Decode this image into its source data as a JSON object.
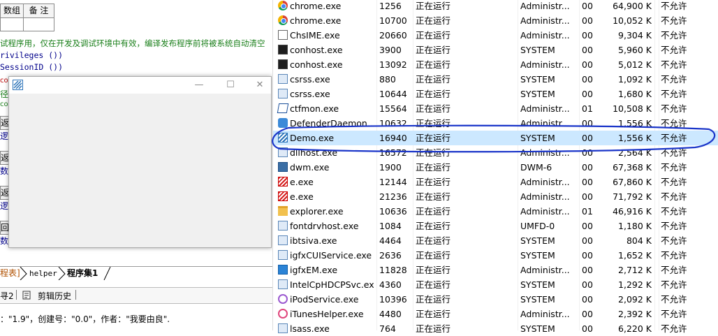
{
  "ide": {
    "table_headers": [
      "数组",
      "备 注"
    ],
    "code_lines": [
      {
        "text": "试程序用，仅在开发及调试环境中有效，编译发布程序前将被系统自动清空",
        "kind": "comment"
      },
      {
        "text": "rivileges ())",
        "kind": "code"
      },
      {
        "text": "SessionID ())",
        "kind": "code"
      }
    ],
    "side_fragments": [
      "co",
      "径",
      "co",
      "返回",
      "逻辑",
      "返",
      "数",
      "返回",
      "逻辑",
      "回",
      "数"
    ],
    "tabs": [
      "程表]",
      "helper",
      "程序集1"
    ],
    "bottom_tabs": [
      "寻2",
      "剪辑历史"
    ],
    "status_text": "：\"1.9\"，创建号：\"0.0\"，作者：\"我要由良\"."
  },
  "demo_window": {
    "minimize": "—",
    "maximize": "☐",
    "close": "✕"
  },
  "processes": [
    {
      "name": "chrome.exe",
      "pid": "1256",
      "status": "正在运行",
      "user": "Administr...",
      "cpu": "00",
      "mem": "64,900 K",
      "uac": "不允许",
      "icon": "chrome-icon"
    },
    {
      "name": "chrome.exe",
      "pid": "10700",
      "status": "正在运行",
      "user": "Administr...",
      "cpu": "00",
      "mem": "10,052 K",
      "uac": "不允许",
      "icon": "chrome-icon"
    },
    {
      "name": "ChsIME.exe",
      "pid": "20660",
      "status": "正在运行",
      "user": "Administr...",
      "cpu": "00",
      "mem": "9,304 K",
      "uac": "不允许",
      "icon": "ime-icon"
    },
    {
      "name": "conhost.exe",
      "pid": "3900",
      "status": "正在运行",
      "user": "SYSTEM",
      "cpu": "00",
      "mem": "5,960 K",
      "uac": "不允许",
      "icon": "console-icon"
    },
    {
      "name": "conhost.exe",
      "pid": "13092",
      "status": "正在运行",
      "user": "Administr...",
      "cpu": "00",
      "mem": "5,012 K",
      "uac": "不允许",
      "icon": "console-icon"
    },
    {
      "name": "csrss.exe",
      "pid": "880",
      "status": "正在运行",
      "user": "SYSTEM",
      "cpu": "00",
      "mem": "1,092 K",
      "uac": "不允许",
      "icon": "process-icon"
    },
    {
      "name": "csrss.exe",
      "pid": "10644",
      "status": "正在运行",
      "user": "SYSTEM",
      "cpu": "00",
      "mem": "1,680 K",
      "uac": "不允许",
      "icon": "process-icon"
    },
    {
      "name": "ctfmon.exe",
      "pid": "15564",
      "status": "正在运行",
      "user": "Administr...",
      "cpu": "01",
      "mem": "10,508 K",
      "uac": "不允许",
      "icon": "ctfmon-icon"
    },
    {
      "name": "DefenderDaemon...",
      "pid": "10632",
      "status": "正在运行",
      "user": "Administr...",
      "cpu": "00",
      "mem": "1,556 K",
      "uac": "不允许",
      "icon": "defender-icon"
    },
    {
      "name": "Demo.exe",
      "pid": "16940",
      "status": "正在运行",
      "user": "SYSTEM",
      "cpu": "00",
      "mem": "1,556 K",
      "uac": "不允许",
      "icon": "demo-icon",
      "selected": true
    },
    {
      "name": "dllhost.exe",
      "pid": "16572",
      "status": "正在运行",
      "user": "Administr...",
      "cpu": "00",
      "mem": "2,564 K",
      "uac": "不允许",
      "icon": "process-icon"
    },
    {
      "name": "dwm.exe",
      "pid": "1900",
      "status": "正在运行",
      "user": "DWM-6",
      "cpu": "00",
      "mem": "67,368 K",
      "uac": "不允许",
      "icon": "dwm-icon"
    },
    {
      "name": "e.exe",
      "pid": "12144",
      "status": "正在运行",
      "user": "Administr...",
      "cpu": "00",
      "mem": "67,860 K",
      "uac": "不允许",
      "icon": "e-icon"
    },
    {
      "name": "e.exe",
      "pid": "21236",
      "status": "正在运行",
      "user": "Administr...",
      "cpu": "00",
      "mem": "71,792 K",
      "uac": "不允许",
      "icon": "e-icon"
    },
    {
      "name": "explorer.exe",
      "pid": "10636",
      "status": "正在运行",
      "user": "Administr...",
      "cpu": "01",
      "mem": "46,916 K",
      "uac": "不允许",
      "icon": "folder-icon"
    },
    {
      "name": "fontdrvhost.exe",
      "pid": "1084",
      "status": "正在运行",
      "user": "UMFD-0",
      "cpu": "00",
      "mem": "1,180 K",
      "uac": "不允许",
      "icon": "process-icon"
    },
    {
      "name": "ibtsiva.exe",
      "pid": "4464",
      "status": "正在运行",
      "user": "SYSTEM",
      "cpu": "00",
      "mem": "804 K",
      "uac": "不允许",
      "icon": "process-icon"
    },
    {
      "name": "igfxCUIService.exe",
      "pid": "2636",
      "status": "正在运行",
      "user": "SYSTEM",
      "cpu": "00",
      "mem": "1,652 K",
      "uac": "不允许",
      "icon": "process-icon"
    },
    {
      "name": "igfxEM.exe",
      "pid": "11828",
      "status": "正在运行",
      "user": "Administr...",
      "cpu": "00",
      "mem": "2,712 K",
      "uac": "不允许",
      "icon": "intel-icon"
    },
    {
      "name": "IntelCpHDCPSvc.exe",
      "pid": "4360",
      "status": "正在运行",
      "user": "SYSTEM",
      "cpu": "00",
      "mem": "1,292 K",
      "uac": "不允许",
      "icon": "process-icon"
    },
    {
      "name": "iPodService.exe",
      "pid": "10396",
      "status": "正在运行",
      "user": "SYSTEM",
      "cpu": "00",
      "mem": "2,092 K",
      "uac": "不允许",
      "icon": "ipod-icon"
    },
    {
      "name": "iTunesHelper.exe",
      "pid": "4480",
      "status": "正在运行",
      "user": "Administr...",
      "cpu": "00",
      "mem": "2,392 K",
      "uac": "不允许",
      "icon": "itunes-icon"
    },
    {
      "name": "lsass.exe",
      "pid": "764",
      "status": "正在运行",
      "user": "SYSTEM",
      "cpu": "00",
      "mem": "6,220 K",
      "uac": "不允许",
      "icon": "process-icon"
    }
  ],
  "colors": {
    "selection": "#cce8ff",
    "annotation": "#1a35c9",
    "comment": "#1a7f1a"
  }
}
